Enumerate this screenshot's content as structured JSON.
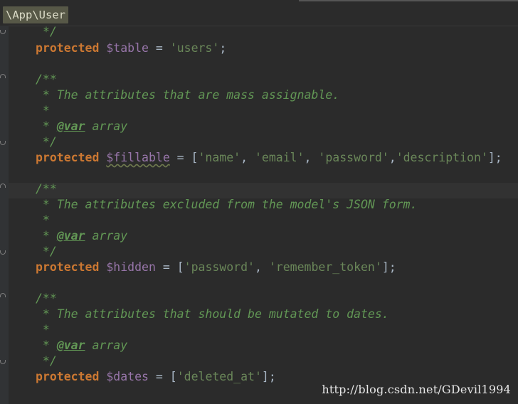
{
  "breadcrumb": {
    "label": "\\App\\User"
  },
  "code": {
    "l01": {
      "doc": "*/"
    },
    "l02": {
      "kw": "protected",
      "var": "$table",
      "eq": " = ",
      "str": "'users'",
      "end": ";"
    },
    "l03": {
      "doc": "/**"
    },
    "l04": {
      "doc": " * The attributes that are mass assignable."
    },
    "l05": {
      "doc": " *"
    },
    "l06": {
      "pre": " * ",
      "tag": "@var",
      "post": " array"
    },
    "l07": {
      "doc": " */"
    },
    "l08": {
      "kw": "protected",
      "var": "$fillable",
      "eq": " = [",
      "s1": "'name'",
      "c1": ", ",
      "s2": "'email'",
      "c2": ", ",
      "s3": "'password'",
      "c3": ",",
      "s4": "'description'",
      "end": "];"
    },
    "l09": {
      "doc": "/**"
    },
    "l10": {
      "doc": " * The attributes excluded from the model's JSON form."
    },
    "l11": {
      "doc": " *"
    },
    "l12": {
      "pre": " * ",
      "tag": "@var",
      "post": " array"
    },
    "l13": {
      "doc": " */"
    },
    "l14": {
      "kw": "protected",
      "var": "$hidden",
      "eq": " = [",
      "s1": "'password'",
      "c1": ", ",
      "s2": "'remember_token'",
      "end": "];"
    },
    "l15": {
      "doc": "/**"
    },
    "l16": {
      "doc": " * The attributes that should be mutated to dates."
    },
    "l17": {
      "doc": " *"
    },
    "l18": {
      "pre": " * ",
      "tag": "@var",
      "post": " array"
    },
    "l19": {
      "doc": " */"
    },
    "l20": {
      "kw": "protected",
      "var": "$dates",
      "eq": " = [",
      "s1": "'deleted_at'",
      "end": "];"
    }
  },
  "watermark": {
    "text": "http://blog.csdn.net/GDevil1994"
  },
  "colors": {
    "background": "#2b2b2b",
    "keyword": "#cc7832",
    "variable": "#9876aa",
    "string": "#6a8759",
    "doc_comment": "#629755",
    "default_text": "#a9b7c6"
  }
}
